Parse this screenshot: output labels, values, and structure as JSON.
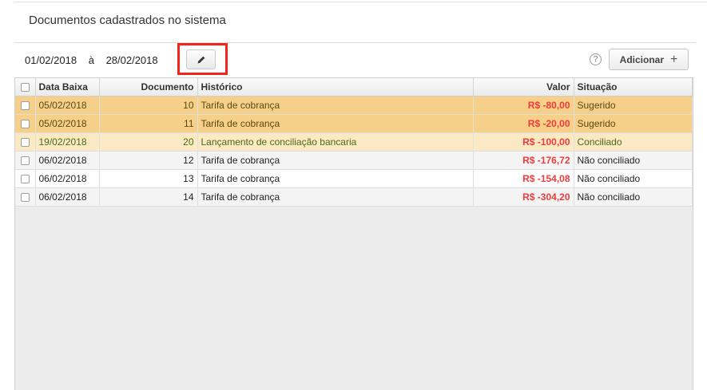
{
  "header": {
    "title": "Documentos cadastrados no sistema"
  },
  "filter": {
    "date_from": "01/02/2018",
    "separator": "à",
    "date_to": "28/02/2018"
  },
  "toolbar": {
    "help_glyph": "?",
    "add_label": "Adicionar",
    "add_icon": "plus-icon"
  },
  "table": {
    "columns": {
      "data_baixa": "Data Baixa",
      "documento": "Documento",
      "historico": "Histórico",
      "valor": "Valor",
      "situacao": "Situação"
    },
    "rows": [
      {
        "data": "05/02/2018",
        "documento": "10",
        "historico": "Tarifa de cobrança",
        "valor": "R$ -80,00",
        "situacao": "Sugerido",
        "status": "sugerido"
      },
      {
        "data": "05/02/2018",
        "documento": "11",
        "historico": "Tarifa de cobrança",
        "valor": "R$ -20,00",
        "situacao": "Sugerido",
        "status": "sugerido"
      },
      {
        "data": "19/02/2018",
        "documento": "20",
        "historico": "Lançamento de conciliação bancaria",
        "valor": "R$ -100,00",
        "situacao": "Conciliado",
        "status": "conciliado"
      },
      {
        "data": "06/02/2018",
        "documento": "12",
        "historico": "Tarifa de cobrança",
        "valor": "R$ -176,72",
        "situacao": "Não conciliado",
        "status": "nao"
      },
      {
        "data": "06/02/2018",
        "documento": "13",
        "historico": "Tarifa de cobrança",
        "valor": "R$ -154,08",
        "situacao": "Não conciliado",
        "status": "nao"
      },
      {
        "data": "06/02/2018",
        "documento": "14",
        "historico": "Tarifa de cobrança",
        "valor": "R$ -304,20",
        "situacao": "Não conciliado",
        "status": "nao"
      }
    ]
  },
  "colors": {
    "sugerido_row": "#f6cf89",
    "conciliado_row": "#fbe9c3",
    "negative_value": "#ef3b3b",
    "highlight_box": "#f2241c"
  }
}
